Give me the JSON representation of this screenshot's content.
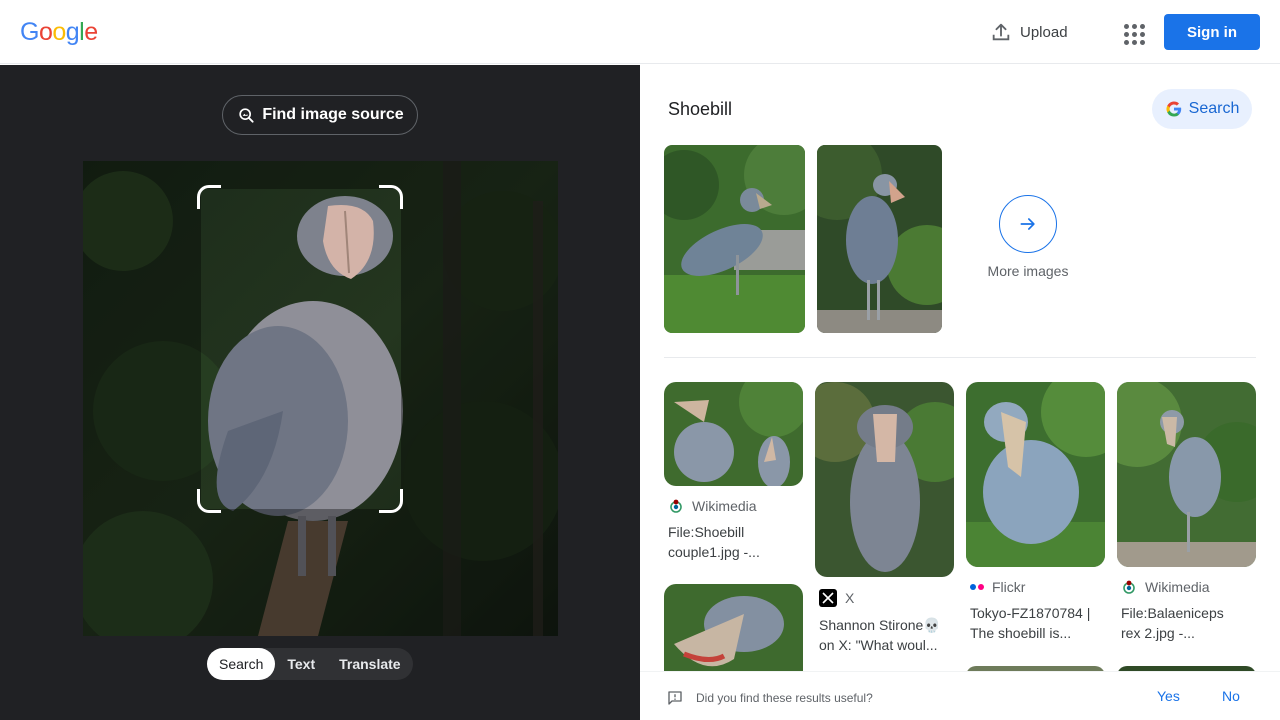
{
  "header": {
    "logo_letters": [
      {
        "ch": "G",
        "color": "#4285F4"
      },
      {
        "ch": "o",
        "color": "#EA4335"
      },
      {
        "ch": "o",
        "color": "#FBBC05"
      },
      {
        "ch": "g",
        "color": "#4285F4"
      },
      {
        "ch": "l",
        "color": "#34A853"
      },
      {
        "ch": "e",
        "color": "#EA4335"
      }
    ],
    "upload_label": "Upload",
    "apps_icon": "apps-grid-icon",
    "signin_label": "Sign in"
  },
  "lens": {
    "find_source_label": "Find image source",
    "tabs": [
      "Search",
      "Text",
      "Translate"
    ],
    "active_tab": "Search"
  },
  "results": {
    "title": "Shoebill",
    "search_label": "Search",
    "more_images_label": "More images",
    "cards": [
      {
        "source": "Wikimedia",
        "title_line1": "File:Shoebill",
        "title_line2": "couple1.jpg -..."
      },
      {
        "source": "X",
        "title_line1": "Shannon Stirone💀",
        "title_line2": "on X: \"What woul..."
      },
      {
        "source": "Flickr",
        "title_line1": "Tokyo-FZ1870784 |",
        "title_line2": "The shoebill is..."
      },
      {
        "source": "Wikimedia",
        "title_line1": "File:Balaeniceps",
        "title_line2": "rex 2.jpg -..."
      }
    ]
  },
  "feedback": {
    "question": "Did you find these results useful?",
    "yes_label": "Yes",
    "no_label": "No"
  },
  "colors": {
    "accent": "#1a73e8",
    "panel_dark": "#202124"
  }
}
